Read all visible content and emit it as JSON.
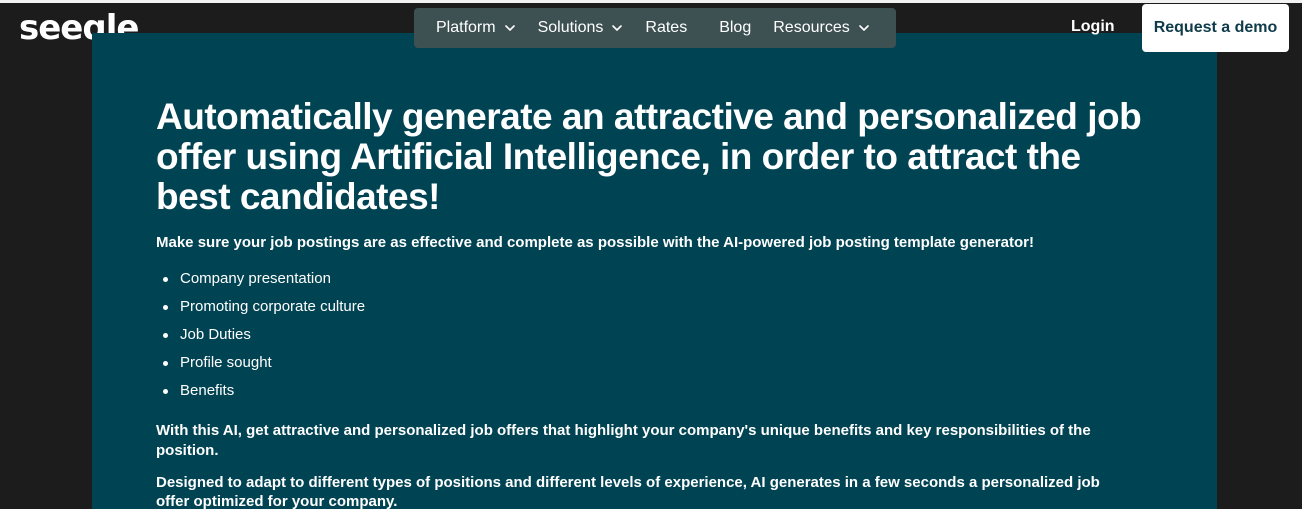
{
  "header": {
    "logo_text": "seeqle",
    "nav": [
      {
        "label": "Platform",
        "has_dropdown": true,
        "icon": "chevron-down-icon"
      },
      {
        "label": "Solutions",
        "has_dropdown": true,
        "icon": "chevron-down-icon"
      },
      {
        "label": "Rates",
        "has_dropdown": false
      },
      {
        "label": "Blog",
        "has_dropdown": false
      },
      {
        "label": "Resources",
        "has_dropdown": true,
        "icon": "chevron-down-icon"
      }
    ],
    "login_label": "Login",
    "demo_label": "Request a demo"
  },
  "hero": {
    "title": "Automatically generate an attractive and personalized job offer using Artificial Intelligence, in order to attract the best candidates!",
    "intro": "Make sure your job postings are as effective and complete as possible with the AI-powered job posting template generator!",
    "features": [
      "Company presentation",
      "Promoting corporate culture",
      "Job Duties",
      "Profile sought",
      "Benefits"
    ],
    "paragraph1": "With this AI, get attractive and personalized job offers that highlight your company's unique benefits and key responsibilities of the position.",
    "paragraph2": "Designed to adapt to different types of positions and different levels of experience, AI generates in a few seconds a personalized job offer optimized for your company."
  },
  "colors": {
    "page_background": "#1c1c1c",
    "hero_background": "#004353",
    "nav_background": "#3e5152",
    "button_text": "#0f3b4a"
  }
}
